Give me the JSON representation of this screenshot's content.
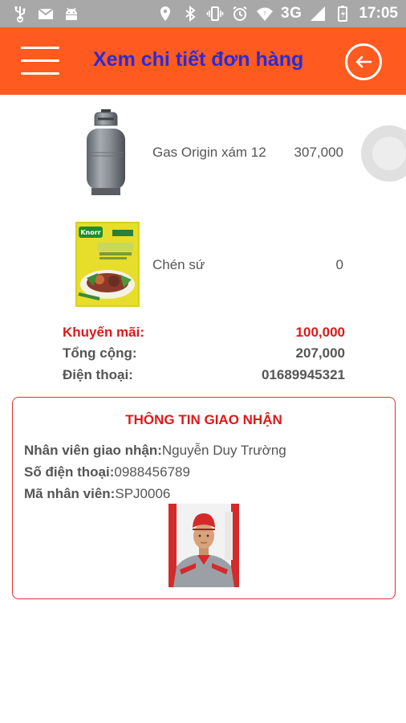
{
  "status_bar": {
    "network": "3G",
    "time": "17:05",
    "icons_left": [
      "usb-icon",
      "mail-icon",
      "android-icon"
    ],
    "icons_right": [
      "location-icon",
      "bluetooth-icon",
      "vibrate-icon",
      "alarm-icon",
      "wifi-icon",
      "signal-icon",
      "battery-icon"
    ]
  },
  "app_bar": {
    "title": "Xem chi tiết đơn hàng",
    "menu_icon": "hamburger-menu-icon",
    "back_icon": "back-arrow-icon"
  },
  "order_items": [
    {
      "name": "Gas Origin xám 12",
      "price": "307,000",
      "image": "gas-cylinder-image"
    },
    {
      "name": "Chén sứ",
      "price": "0",
      "image": "knorr-product-image"
    }
  ],
  "summary": {
    "promotion_label": "Khuyến mãi:",
    "promotion_value": "100,000",
    "total_label": "Tổng cộng:",
    "total_value": "207,000",
    "phone_label": "Điện thoại:",
    "phone_value": "01689945321"
  },
  "delivery": {
    "title": "THÔNG TIN GIAO NHẬN",
    "staff_label": "Nhân viên giao nhận:",
    "staff_value": "Nguyễn Duy Trường",
    "phone_label": "Số điện thoại:",
    "phone_value": "0988456789",
    "id_label": "Mã nhân viên:",
    "id_value": "SPJ0006"
  },
  "colors": {
    "app_bar": "#ff5a1f",
    "title": "#2b2bd6",
    "accent_red": "#e01818",
    "status_bar": "#a8a8a8"
  }
}
